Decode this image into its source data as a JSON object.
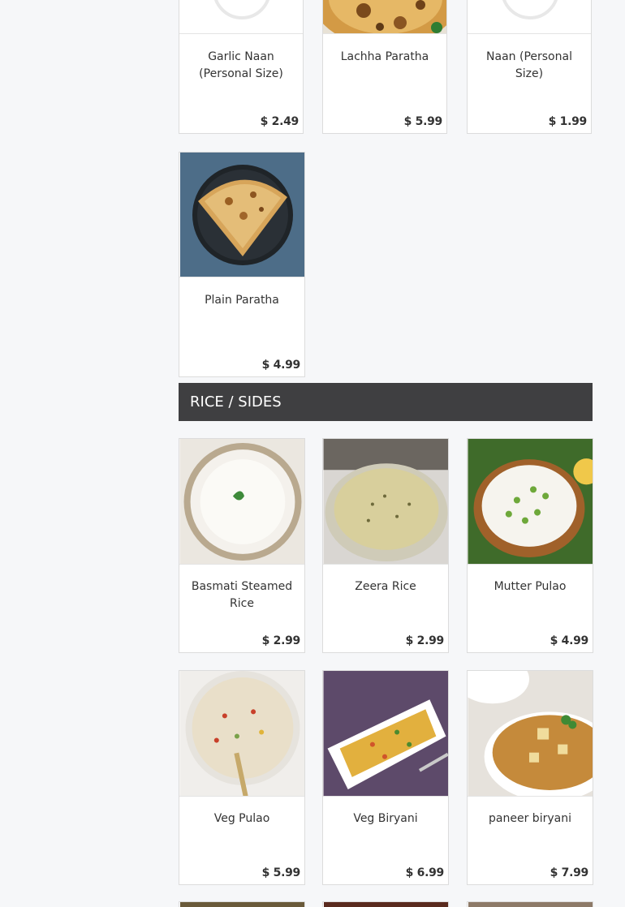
{
  "sections": {
    "rice_sides": {
      "title": "RICE / SIDES"
    }
  },
  "breads": [
    {
      "name": "Garlic Naan (Personal Size)",
      "price": "$ 2.49",
      "image": "placeholder-icon"
    },
    {
      "name": "Lachha Paratha",
      "price": "$ 5.99",
      "image": "lachha-paratha-photo"
    },
    {
      "name": "Naan (Personal Size)",
      "price": "$ 1.99",
      "image": "placeholder-icon"
    },
    {
      "name": "Plain Paratha",
      "price": "$ 4.99",
      "image": "plain-paratha-photo"
    }
  ],
  "rice": [
    {
      "name": "Basmati Steamed Rice",
      "price": "$ 2.99",
      "image": "basmati-rice-photo"
    },
    {
      "name": "Zeera Rice",
      "price": "$ 2.99",
      "image": "zeera-rice-photo"
    },
    {
      "name": "Mutter Pulao",
      "price": "$ 4.99",
      "image": "mutter-pulao-photo"
    },
    {
      "name": "Veg Pulao",
      "price": "$ 5.99",
      "image": "veg-pulao-photo"
    },
    {
      "name": "Veg Biryani",
      "price": "$ 6.99",
      "image": "veg-biryani-photo"
    },
    {
      "name": "paneer biryani",
      "price": "$ 7.99",
      "image": "paneer-biryani-photo"
    }
  ],
  "colors": {
    "page_background": "#f6f7f9",
    "section_header_background": "#3f3f41",
    "text": "#333333"
  }
}
